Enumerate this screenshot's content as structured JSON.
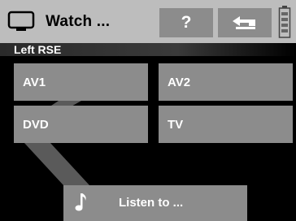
{
  "header": {
    "title": "Watch ...",
    "help_label": "?",
    "icons": {
      "watch": "tv-icon",
      "back": "return-arrow-icon",
      "battery": "battery-icon"
    }
  },
  "section": {
    "label": "Left RSE"
  },
  "sources": [
    {
      "label": "AV1"
    },
    {
      "label": "AV2"
    },
    {
      "label": "DVD"
    },
    {
      "label": "TV"
    }
  ],
  "listen": {
    "label": "Listen to ...",
    "icon": "music-note-icon"
  },
  "colors": {
    "header_bg": "#bdbdbd",
    "button_bg": "#8c8c8c",
    "text_light": "#ffffff",
    "screen_bg": "#000000"
  }
}
